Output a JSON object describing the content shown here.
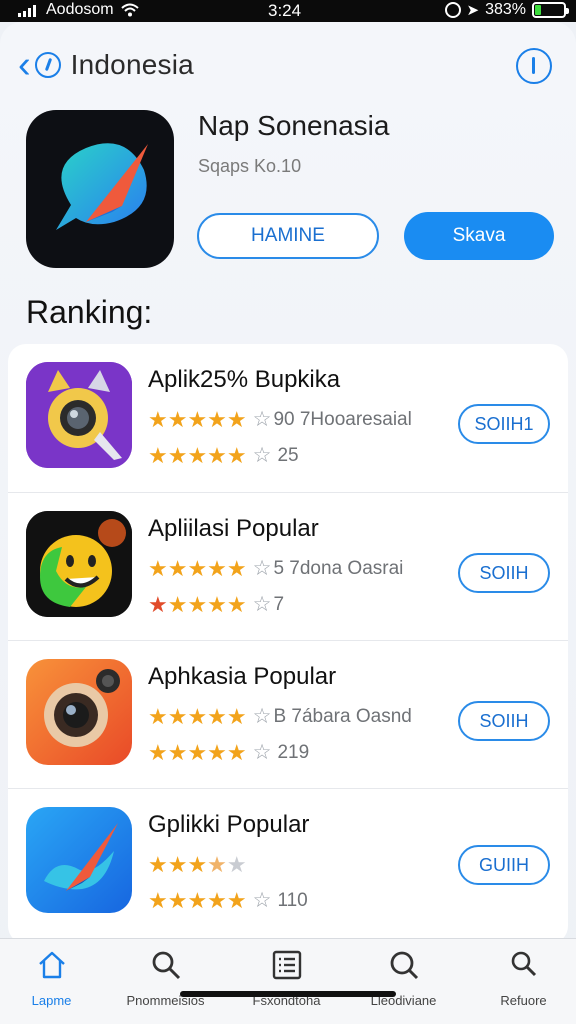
{
  "status_bar": {
    "carrier": "Aodosom",
    "time": "3:24",
    "battery_percent": "383%",
    "battery_level": 0.2,
    "battery_color": "#3ddc3d"
  },
  "nav": {
    "title": "Indonesia",
    "back_icon": "chevron-left-icon",
    "info_icon": "info-icon"
  },
  "hero": {
    "title": "Nap Sonenasia",
    "subtitle": "Sqaps Ko.10",
    "btn_outline_label": "HAMINE",
    "btn_solid_label": "Skava",
    "accent": "#1a8cf2"
  },
  "section": {
    "title": "Ranking:"
  },
  "apps": [
    {
      "name": "Aplik25% Bupkika",
      "rating_line1": "90 7Hooaresaial",
      "rating_line2": "25",
      "get_label": "SOIIH1",
      "icon": "camera-cat-icon",
      "icon_bg": "#7a35c8"
    },
    {
      "name": "Apliilasi Popular",
      "rating_line1": "5 7dona Oasrai",
      "rating_line2": "7",
      "get_label": "SOIIH",
      "icon": "smiley-face-icon",
      "icon_bg": "#111"
    },
    {
      "name": "Aphkasia Popular",
      "rating_line1": "B 7ábara Oasnd",
      "rating_line2": "219",
      "get_label": "SOIIH",
      "icon": "camera-lens-icon",
      "icon_bg": "#f06a2a"
    },
    {
      "name": "Gplikki Popular",
      "rating_line1": "",
      "rating_line2": "110",
      "get_label": "GUIIH",
      "icon": "compass-arrow-icon",
      "icon_bg": "#1f86ea"
    }
  ],
  "tabs": [
    {
      "label": "Lapme",
      "icon": "home-icon",
      "active": true
    },
    {
      "label": "Pnommeisios",
      "icon": "search-icon",
      "active": false
    },
    {
      "label": "Fsxondtoha",
      "icon": "list-icon",
      "active": false
    },
    {
      "label": "Lleodiviane",
      "icon": "search-icon",
      "active": false
    },
    {
      "label": "Refuore",
      "icon": "search-icon",
      "active": false
    }
  ],
  "star_color": "#f2a31b"
}
